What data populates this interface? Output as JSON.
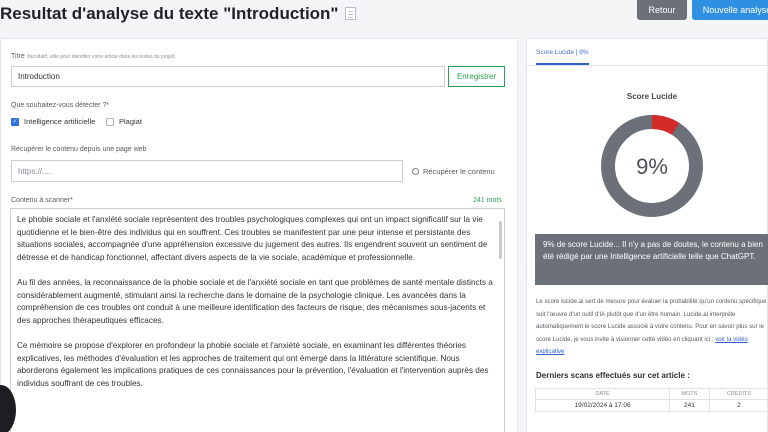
{
  "page": {
    "title": "Resultat d'analyse du texte \"Introduction\"",
    "back_label": "Retour",
    "new_label": "Nouvelle analyse"
  },
  "form": {
    "title_label": "Titre",
    "title_hint": "(facultatif, utile pour identifier votre article dans les textes du projet)",
    "title_value": "Introduction",
    "save_label": "Enregistrer",
    "detect_label": "Que souhaitez-vous détecter ?*",
    "option_ai": "Intelligence artificielle",
    "option_plagiat": "Plagiat",
    "url_label": "Récupérer le contenu depuis une page web",
    "url_placeholder": "https://.....",
    "fetch_label": "Récupérer le contenu",
    "content_label": "Contenu à scanner*",
    "word_count": "241 mots",
    "paragraphs": [
      "Le phobie sociale et l'anxiété sociale représentent des troubles psychologiques complexes qui ont un impact significatif sur la vie quotidienne et le bien-être des individus qui en souffrent. Ces troubles se manifestent par une peur intense et persistante des situations sociales, accompagnée d'une appréhension excessive du jugement des autres. Ils engendrent souvent un sentiment de détresse et de handicap fonctionnel, affectant divers aspects de la vie sociale, académique et professionnelle.",
      "Au fil des années, la reconnaissance de la phobie sociale et de l'anxiété sociale en tant que problèmes de santé mentale distincts a considérablement augmenté, stimulant ainsi la recherche dans le domaine de la psychologie clinique. Les avancées dans la compréhension de ces troubles ont conduit à une meilleure identification des facteurs de risque, des mécanismes sous-jacents et des approches thérapeutiques efficaces.",
      "Ce mémoire se propose d'explorer en profondeur la phobie sociale et l'anxiété sociale, en examinant les différentes théories explicatives, les méthodes d'évaluation et les approches de traitement qui ont émergé dans la littérature scientifique. Nous aborderons également les implications pratiques de ces connaissances pour la prévention, l'évaluation et l'intervention auprès des individus souffrant de ces troubles."
    ]
  },
  "result": {
    "tab_label": "Score Lucide | 9%",
    "score_title": "Score Lucide",
    "score_value": 9,
    "score_text": "9%",
    "ring_color": "#6b7079",
    "accent_color": "#d42a2a",
    "info_text": "9% de score Lucide... Il n'y a pas de doutes, le contenu a bien été rédigé par une Intelligence artificielle telle que ChatGPT.",
    "description": "Le score lucide.ai sert de mesure pour évaluer la probabilité qu'un contenu spécifique soit l'œuvre d'un outil d'IA plutôt que d'un être humain. Lucide.ai interprète automatiquement le score Lucide associé à votre contenu. Pour en savoir plus sur le score Lucide, je vous invite à visionner cette vidéo en cliquant ici :",
    "video_link": "voir la vidéo explicative",
    "scans_title": "Derniers scans effectués sur cet article :",
    "scans_headers": [
      "DATE",
      "MOTS",
      "CRÉDITS"
    ],
    "scans_rows": [
      [
        "19/02/2024 à 17:06",
        "241",
        "2"
      ]
    ]
  }
}
